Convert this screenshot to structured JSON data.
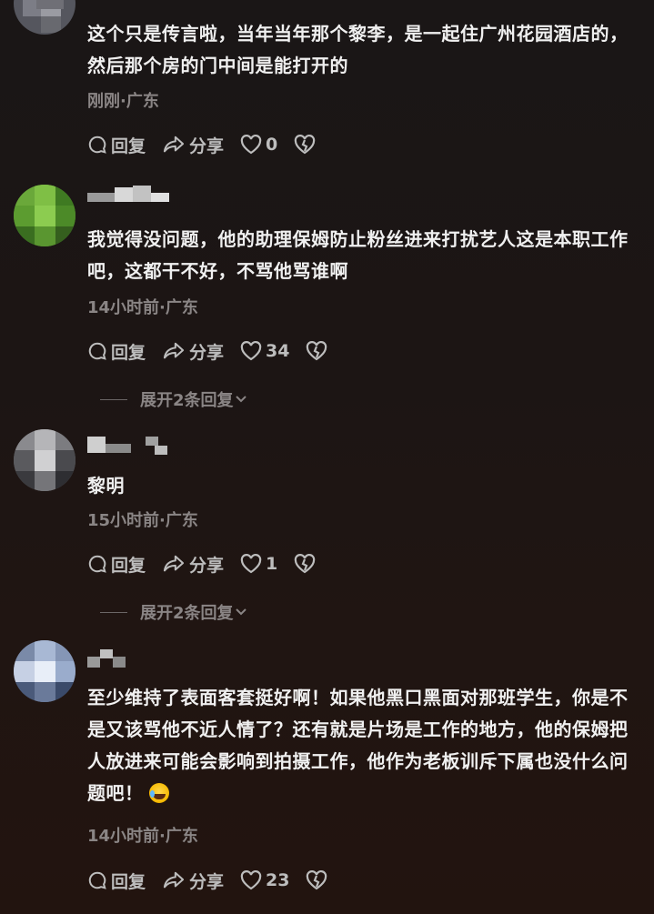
{
  "comments": [
    {
      "text": "这个只是传言啦，当年当年那个黎李，是一起住广州花园酒店的，然后那个房的门中间是能打开的",
      "meta": "刚刚·广东",
      "reply_label": "回复",
      "share_label": "分享",
      "likes": "0"
    },
    {
      "text": "我觉得没问题，他的助理保姆防止粉丝进来打扰艺人这是本职工作吧，这都干不好，不骂他骂谁啊",
      "meta": "14小时前·广东",
      "reply_label": "回复",
      "share_label": "分享",
      "likes": "34",
      "expand_label": "展开2条回复"
    },
    {
      "text": "黎明",
      "meta": "15小时前·广东",
      "reply_label": "回复",
      "share_label": "分享",
      "likes": "1",
      "expand_label": "展开2条回复"
    },
    {
      "text": "至少维持了表面客套挺好啊！如果他黑口黑面对那班学生，你是不是又该骂他不近人情了？还有就是片场是工作的地方，他的保姆把人放进来可能会影响到拍摄工作，他作为老板训斥下属也没什么问题吧！",
      "meta": "14小时前·广东",
      "reply_label": "回复",
      "share_label": "分享",
      "likes": "23"
    }
  ],
  "icons": {
    "reply": "reply-icon",
    "share": "share-icon",
    "like": "heart-icon",
    "dislike": "broken-heart-icon",
    "expand": "chevron-down-icon",
    "emoji": "laugh-cry-emoji"
  },
  "colors": {
    "background": "#1c1514",
    "text": "#f0f0f0",
    "meta": "#8a8585",
    "action": "#bdbdbd"
  }
}
